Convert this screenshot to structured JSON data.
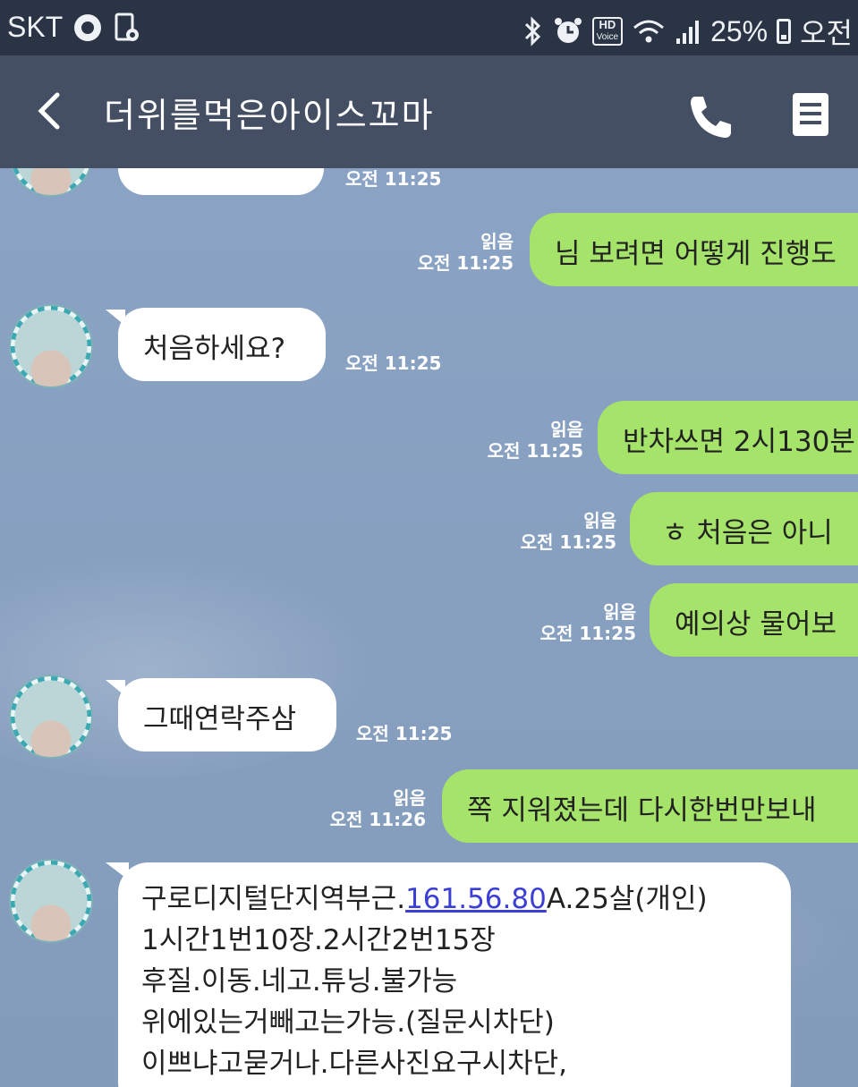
{
  "statusbar": {
    "carrier": "SKT",
    "battery": "25%",
    "clock": "오전",
    "hd_label": "HD",
    "hd_sub": "Voice"
  },
  "header": {
    "title": "더위를먹은아이스꼬마"
  },
  "messages": [
    {
      "side": "in",
      "text": "",
      "time": "오전 11:25"
    },
    {
      "side": "out",
      "text": "님 보려면 어떻게 진행도",
      "read": "읽음",
      "time": "오전 11:25"
    },
    {
      "side": "in",
      "text": "처음하세요?",
      "time": "오전 11:25"
    },
    {
      "side": "out",
      "text": "반차쓰면 2시130분",
      "read": "읽음",
      "time": "오전 11:25"
    },
    {
      "side": "out",
      "text": "ㅎ 처음은 아니",
      "read": "읽음",
      "time": "오전 11:25"
    },
    {
      "side": "out",
      "text": "예의상 물어보",
      "read": "읽음",
      "time": "오전 11:25"
    },
    {
      "side": "in",
      "text": "그때연락주삼",
      "time": "오전 11:25"
    },
    {
      "side": "out",
      "text": "쪽 지워졌는데 다시한번만보내",
      "read": "읽음",
      "time": "오전 11:26"
    }
  ],
  "last_message": {
    "line1_before": "구로디지털단지역부근.",
    "line1_link": "161.56.80",
    "line1_after": "A.25살(개인)",
    "line2": "1시간1번10장.2시간2번15장",
    "line3": "후질.이동.네고.튜닝.불가능",
    "line4": "위에있는거빼고는가능.(질문시차단)",
    "line5": "이쁘냐고묻거나.다른사진요구시차단,"
  }
}
